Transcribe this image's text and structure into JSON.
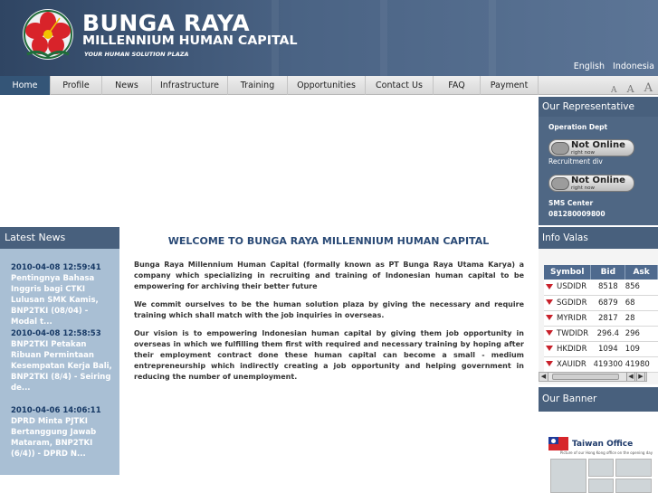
{
  "brand": {
    "title": "BUNGA RAYA",
    "subtitle": "MILLENNIUM HUMAN CAPITAL",
    "tagline": "YOUR HUMAN SOLUTION PLAZA"
  },
  "languages": [
    "English",
    "Indonesia"
  ],
  "nav": {
    "items": [
      {
        "label": "Home",
        "active": true
      },
      {
        "label": "Profile"
      },
      {
        "label": "News"
      },
      {
        "label": "Infrastructure"
      },
      {
        "label": "Training"
      },
      {
        "label": "Opportunities"
      },
      {
        "label": "Contact Us"
      },
      {
        "label": "FAQ"
      },
      {
        "label": "Payment"
      }
    ],
    "text_size": [
      "A",
      "A",
      "A"
    ]
  },
  "latest_news": {
    "heading": "Latest News",
    "items": [
      {
        "date": "2010-04-08 12:59:41",
        "text": "Pentingnya Bahasa Inggris bagi CTKI Lulusan SMK Kamis, BNP2TKI (08/04) - Modal t..."
      },
      {
        "date": "2010-04-08 12:58:53",
        "text": "BNP2TKI Petakan Ribuan Permintaan Kesempatan Kerja Bali, BNP2TKI (8/4) - Seiring de..."
      },
      {
        "date": "2010-04-06 14:06:11",
        "text": "DPRD Minta PJTKI Bertanggung Jawab Mataram, BNP2TKI (6/4)) - DPRD N..."
      }
    ]
  },
  "main": {
    "title": "WELCOME TO BUNGA RAYA MILLENNIUM HUMAN CAPITAL",
    "paragraphs": [
      "Bunga Raya Millennium Human Capital (formally known as PT Bunga Raya Utama Karya) a company which specializing in recruiting and training of Indonesian human capital to be empowering for archiving their better future",
      "We commit ourselves to be the human solution plaza by giving the necessary and require training which shall match with the job inquiries in overseas.",
      "Our vision is to empowering Indonesian human capital by giving them job opportunity in overseas in which we fulfilling them first with required and necessary training by hoping after their employment contract done these human capital can become a small - medium entrepreneurship which indirectly creating a job opportunity and helping government in reducing the number of unemployment."
    ]
  },
  "representative": {
    "heading": "Our Representative",
    "operation_dept": "Operation Dept",
    "online_title": "Not Online",
    "online_sub": "right now",
    "recruitment": "Recruitment div",
    "sms_label": "SMS Center",
    "sms_number": "081280009800"
  },
  "valas": {
    "heading": "Info Valas",
    "columns": [
      "Symbol",
      "Bid",
      "Ask"
    ],
    "rows": [
      {
        "symbol": "USDIDR",
        "bid": "8518",
        "ask": "856"
      },
      {
        "symbol": "SGDIDR",
        "bid": "6879",
        "ask": "68"
      },
      {
        "symbol": "MYRIDR",
        "bid": "2817",
        "ask": "28"
      },
      {
        "symbol": "TWDIDR",
        "bid": "296.4",
        "ask": "296"
      },
      {
        "symbol": "HKDIDR",
        "bid": "1094",
        "ask": "109"
      },
      {
        "symbol": "XAUIDR",
        "bid": "419300",
        "ask": "41980"
      }
    ]
  },
  "banner": {
    "heading": "Our Banner",
    "title": "Taiwan Office",
    "caption": "Picture of our Hong Kong office on the opening day"
  },
  "colors": {
    "header": "#3d5675",
    "nav_active": "#345577",
    "section_head": "#48607d",
    "news_bg": "#a9bfd4",
    "title_blue": "#2a4a76",
    "arrow_red": "#c8202a"
  }
}
